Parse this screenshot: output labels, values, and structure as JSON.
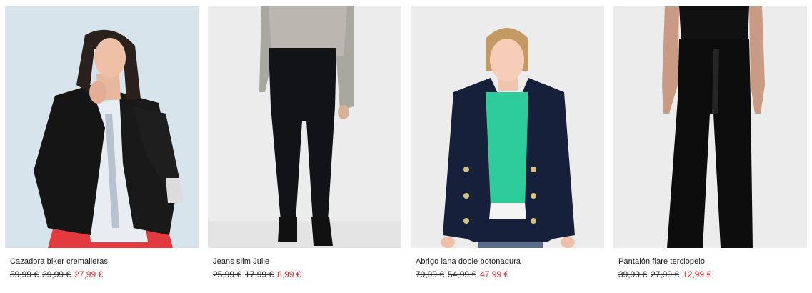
{
  "colors": {
    "sale_price": "#e0282d",
    "text": "#1a1a1a",
    "photo_bg_blue": "#d9e6ef",
    "photo_bg_grey": "#ececec"
  },
  "products": [
    {
      "name": "Cazadora biker cremalleras",
      "old_price_1": "59,99 €",
      "old_price_2": "39,99 €",
      "sale_price": "27,99 €",
      "image": "woman-black-leather-biker-jacket"
    },
    {
      "name": "Jeans slim Julie",
      "old_price_1": "25,99 €",
      "old_price_2": "17,99 €",
      "sale_price": "8,99 €",
      "image": "black-slim-jeans"
    },
    {
      "name": "Abrigo lana doble botonadura",
      "old_price_1": "79,99 €",
      "old_price_2": "54,99 €",
      "sale_price": "47,99 €",
      "image": "navy-double-breasted-wool-coat"
    },
    {
      "name": "Pantalón flare terciopelo",
      "old_price_1": "39,99 €",
      "old_price_2": "27,99 €",
      "sale_price": "12,99 €",
      "image": "black-velvet-flare-trousers"
    }
  ]
}
